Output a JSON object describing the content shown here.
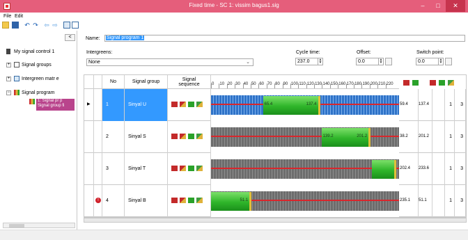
{
  "window": {
    "title": "Fixed time - SC 1: vissim bagus1.sig",
    "minimize": "–",
    "maximize": "□",
    "close": "✕"
  },
  "menu": {
    "file": "File",
    "edit": "Edit"
  },
  "toolbar_icons": [
    "new-icon",
    "save-icon",
    "undo-icon",
    "redo-icon",
    "back-icon",
    "forward-icon",
    "layout-icon",
    "layout-alt-icon"
  ],
  "tree": {
    "collapse_label": "<",
    "root": "My signal control 1",
    "signal_groups": "Signal groups",
    "intergreen": "Intergreen matr e",
    "signal_program": "Signal program",
    "selected_line1": "1: Signal pr p",
    "selected_line2": "Signal group fi"
  },
  "form": {
    "name_label": "Name:",
    "name_value": "Signal program 1",
    "intergreens_label": "Intergreens:",
    "intergreens_value": "None",
    "cycle_label": "Cycle time:",
    "cycle_value": "237.0",
    "offset_label": "Offset:",
    "offset_value": "0.0",
    "switch_label": "Switch point:",
    "switch_value": "0.0"
  },
  "columns": {
    "no": "No",
    "group": "Signal group",
    "sequence": "Signal sequence"
  },
  "timeline": {
    "ticks": [
      "0",
      "10",
      "20",
      "30",
      "40",
      "50",
      "60",
      "70",
      "80",
      "90",
      "100",
      "110",
      "120",
      "130",
      "140",
      "150",
      "160",
      "170",
      "180",
      "190",
      "200",
      "210",
      "220"
    ],
    "max": 237
  },
  "rows": [
    {
      "no": "1",
      "group": "Sinyal U",
      "green_start": 65.4,
      "green_end": 137.4,
      "start_label": "65.4",
      "end_label": "137.4",
      "end_text": "59.4",
      "dur_text": "137.4",
      "col_a": "1",
      "col_b": "3",
      "selected": true,
      "warning": false
    },
    {
      "no": "2",
      "group": "Sinyal S",
      "green_start": 139.2,
      "green_end": 201.2,
      "start_label": "139.2",
      "end_label": "201.2",
      "end_text": "38.2",
      "dur_text": "201.2",
      "col_a": "1",
      "col_b": "3",
      "selected": false,
      "warning": false
    },
    {
      "no": "3",
      "group": "Sinyal T",
      "green_start": 202.4,
      "green_end": 233.6,
      "start_label": "",
      "end_label": "",
      "end_text": "202.4",
      "dur_text": "233.6",
      "col_a": "1",
      "col_b": "3",
      "selected": false,
      "warning": false
    },
    {
      "no": "4",
      "group": "Sinyal B",
      "green_start": 0,
      "green_end": 51.1,
      "start_label": "",
      "end_label": "51.1",
      "end_text": "235.1",
      "dur_text": "51.1",
      "col_a": "1",
      "col_b": "3",
      "selected": false,
      "warning": true
    }
  ],
  "warning_icon": "!",
  "colors": {
    "title_bar": "#e55e7b",
    "selection": "#3399ff",
    "green": "#2fb52a",
    "red": "#d9262c"
  }
}
